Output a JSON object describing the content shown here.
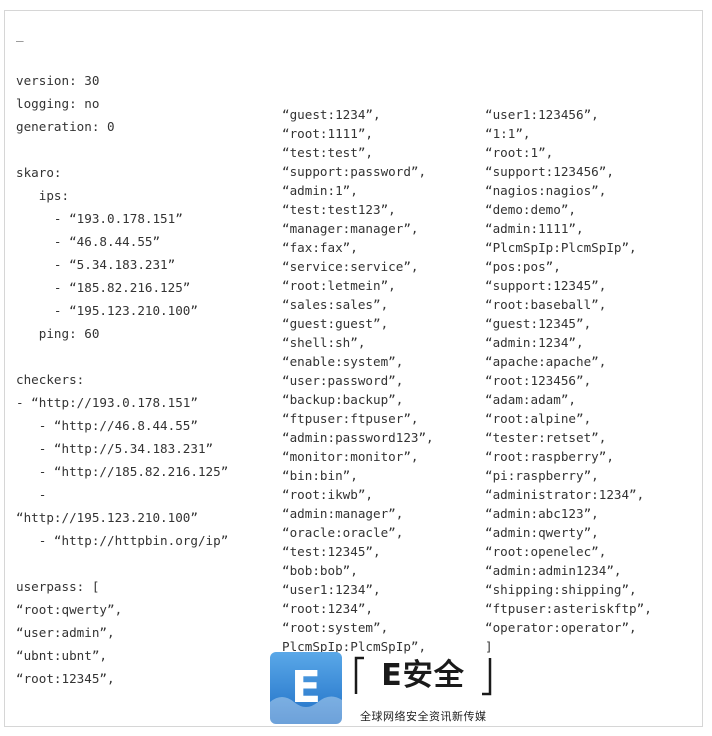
{
  "config": {
    "column1": [
      "_",
      "",
      "version: 30",
      "logging: no",
      "generation: 0",
      "",
      "skaro:",
      "   ips:",
      "     - “193.0.178.151”",
      "     - “46.8.44.55”",
      "     - “5.34.183.231”",
      "     - “185.82.216.125”",
      "     - “195.123.210.100”",
      "   ping: 60",
      "",
      "checkers:",
      "- “http://193.0.178.151”",
      "   - “http://46.8.44.55”",
      "   - “http://5.34.183.231”",
      "   - “http://185.82.216.125”",
      "   -",
      "“http://195.123.210.100”",
      "   - “http://httpbin.org/ip”",
      "",
      "userpass: [",
      "“root:qwerty”,",
      "“user:admin”,",
      "“ubnt:ubnt”,",
      "“root:12345”,"
    ],
    "column2": [
      "“guest:1234”,",
      "“root:1111”,",
      "“test:test”,",
      "“support:password”,",
      "“admin:1”,",
      "“test:test123”,",
      "“manager:manager”,",
      "“fax:fax”,",
      "“service:service”,",
      "“root:letmein”,",
      "“sales:sales”,",
      "“guest:guest”,",
      "“shell:sh”,",
      "“enable:system”,",
      "“user:password”,",
      "“backup:backup”,",
      "“ftpuser:ftpuser”,",
      "“admin:password123”,",
      "“monitor:monitor”,",
      "“bin:bin”,",
      "“root:ikwb”,",
      "“admin:manager”,",
      "“oracle:oracle”,",
      "“test:12345”,",
      "“bob:bob”,",
      "“user1:1234”,",
      "“root:1234”,",
      "“root:system”,",
      "PlcmSpIp:PlcmSpIp”,"
    ],
    "column3": [
      "“user1:123456”,",
      "“1:1”,",
      "“root:1”,",
      "“support:123456”,",
      "“nagios:nagios”,",
      "“demo:demo”,",
      "“admin:1111”,",
      "“PlcmSpIp:PlcmSpIp”,",
      "“pos:pos”,",
      "“support:12345”,",
      "“root:baseball”,",
      "“guest:12345”,",
      "“admin:1234”,",
      "“apache:apache”,",
      "“root:123456”,",
      "“adam:adam”,",
      "“root:alpine”,",
      "“tester:retset”,",
      "“root:raspberry”,",
      "“pi:raspberry”,",
      "“administrator:1234”,",
      "“admin:abc123”,",
      "“admin:qwerty”,",
      "“root:openelec”,",
      "“admin:admin1234”,",
      "“shipping:shipping”,",
      "“ftpuser:asteriskftp”,",
      "“operator:operator”,",
      "]"
    ]
  },
  "watermark": {
    "tile_letter": "E",
    "wordmark": "E安全",
    "tagline": "全球网络安全资讯新传媒",
    "colors": {
      "tile_top": "#5aa8e8",
      "tile_bottom": "#1f6fc6",
      "tile_letter": "#ffffff",
      "bracket": "#1a1a1a"
    }
  }
}
